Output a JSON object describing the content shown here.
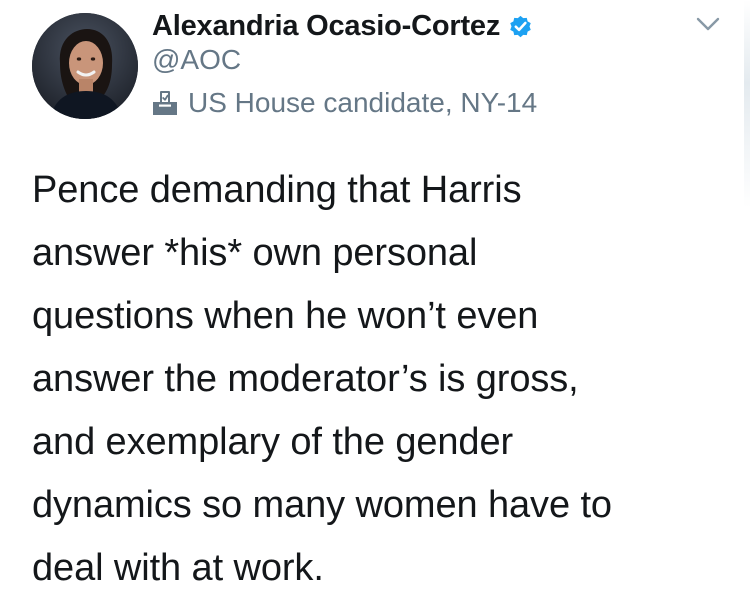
{
  "author": {
    "display_name": "Alexandria Ocasio-Cortez",
    "handle": "@AOC",
    "verified": true,
    "bio_label": "US House candidate, NY-14",
    "bio_icon": "ballot-box-icon",
    "avatar_icon": "profile-photo"
  },
  "actions": {
    "more_icon": "chevron-down-icon"
  },
  "tweet": {
    "text": "Pence demanding that Harris\nanswer *his* own personal\nquestions when he won’t even\nanswer the moderator’s is gross,\nand exemplary of the gender\ndynamics so many women have to\ndeal with at work."
  },
  "colors": {
    "text_primary": "#14171a",
    "text_secondary": "#657786",
    "verified_blue": "#1da1f2",
    "background": "#ffffff"
  }
}
